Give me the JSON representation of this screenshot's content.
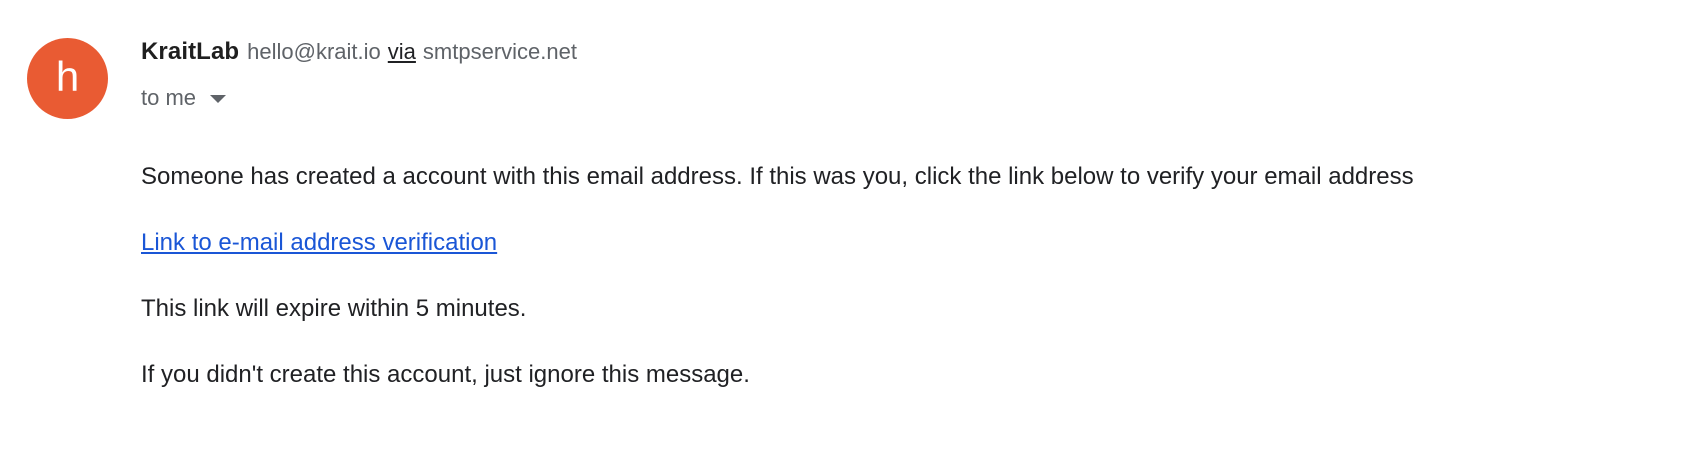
{
  "sender": {
    "avatar_letter": "h",
    "avatar_color": "#e95b33",
    "name": "KraitLab",
    "email": "hello@krait.io",
    "via_label": "via",
    "via_domain": "smtpservice.net"
  },
  "recipient": {
    "label": "to me",
    "dropdown_icon": "chevron-down-icon"
  },
  "body": {
    "paragraph_1": "Someone has created a account with this email address. If this was you, click the link below to verify your email address",
    "link_text": "Link to e-mail address verification",
    "paragraph_2": "This link will expire within 5 minutes.",
    "paragraph_3": "If you didn't create this account, just ignore this message."
  },
  "colors": {
    "link": "#1a56d6",
    "text": "#202124",
    "secondary_text": "#5f6368"
  }
}
